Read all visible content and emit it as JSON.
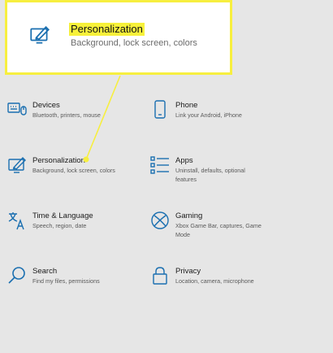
{
  "accent": "#1a6fb0",
  "highlight": "#f7ef3f",
  "callout": {
    "name": "Personalization",
    "description": "Background, lock screen, colors",
    "icon": "personalization-icon"
  },
  "tiles": [
    {
      "name": "Devices",
      "desc1": "Bluetooth, printers, mouse",
      "desc2": "",
      "icon": "keyboard-icon"
    },
    {
      "name": "Phone",
      "desc1": "Link your Android, iPhone",
      "desc2": "",
      "icon": "phone-icon"
    },
    {
      "name": "Personalization",
      "desc1": "Background, lock screen, colors",
      "desc2": "",
      "icon": "personalization-icon"
    },
    {
      "name": "Apps",
      "desc1": "Uninstall, defaults, optional",
      "desc2": "features",
      "icon": "apps-list-icon"
    },
    {
      "name": "Time & Language",
      "desc1": "Speech, region, date",
      "desc2": "",
      "icon": "time-language-icon"
    },
    {
      "name": "Gaming",
      "desc1": "Xbox Game Bar, captures, Game",
      "desc2": "Mode",
      "icon": "xbox-icon"
    },
    {
      "name": "Search",
      "desc1": "Find my files, permissions",
      "desc2": "",
      "icon": "search-icon"
    },
    {
      "name": "Privacy",
      "desc1": "Location, camera, microphone",
      "desc2": "",
      "icon": "lock-icon"
    }
  ]
}
